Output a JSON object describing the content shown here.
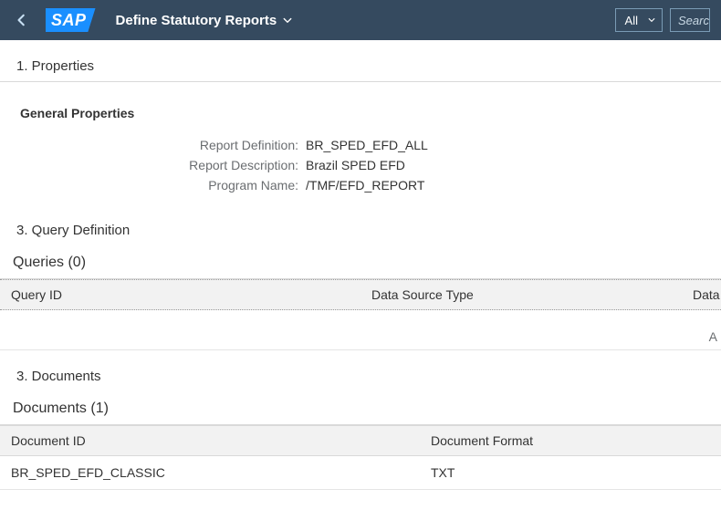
{
  "header": {
    "logo": "SAP",
    "title": "Define Statutory Reports",
    "filter_selected": "All",
    "search_placeholder": "Search"
  },
  "sections": {
    "properties": {
      "heading": "1. Properties"
    },
    "general": {
      "heading": "General Properties",
      "fields": {
        "report_definition": {
          "label": "Report Definition:",
          "value": "BR_SPED_EFD_ALL"
        },
        "report_description": {
          "label": "Report Description:",
          "value": "Brazil SPED EFD"
        },
        "program_name": {
          "label": "Program Name:",
          "value": "/TMF/EFD_REPORT"
        }
      }
    },
    "query_def": {
      "heading": "3. Query Definition"
    },
    "queries": {
      "panel_title": "Queries (0)",
      "columns": {
        "c1": "Query ID",
        "c2": "Data Source Type",
        "c3": "Data"
      },
      "trail": "A"
    },
    "documents_section": {
      "heading": "3. Documents"
    },
    "documents": {
      "panel_title": "Documents (1)",
      "columns": {
        "c1": "Document ID",
        "c2": "Document Format"
      },
      "rows": [
        {
          "id": "BR_SPED_EFD_CLASSIC",
          "format": "TXT"
        }
      ]
    }
  }
}
